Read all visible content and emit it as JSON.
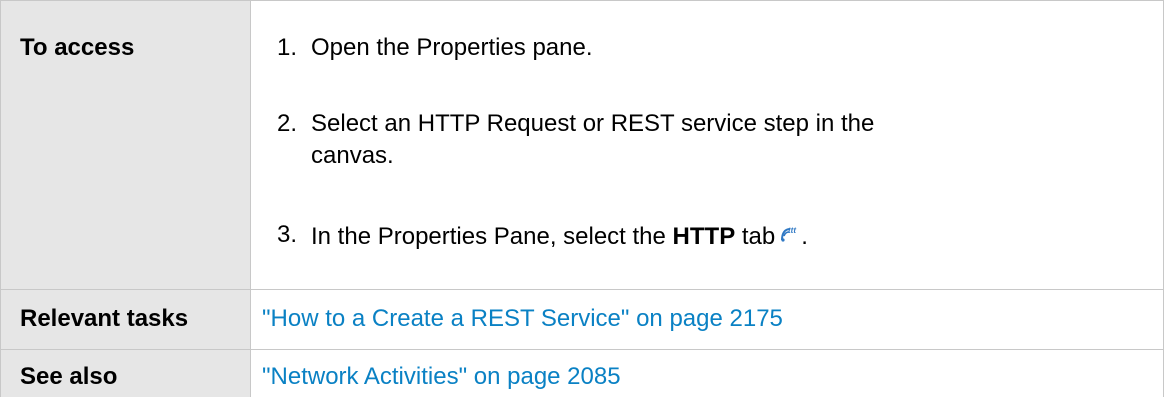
{
  "table": {
    "rows": {
      "access": {
        "label": "To access",
        "steps": [
          {
            "num": "1.",
            "text": "Open the Properties pane."
          },
          {
            "num": "2.",
            "text": "Select an HTTP Request or REST service step in the canvas."
          },
          {
            "num": "3.",
            "text_before": "In the Properties Pane, select the ",
            "bold": "HTTP",
            "text_after": " tab",
            "icon": "http-tab-icon",
            "end": "."
          }
        ]
      },
      "tasks": {
        "label": "Relevant tasks",
        "link": "\"How to a Create a REST Service\" on page 2175"
      },
      "see_also": {
        "label": "See also",
        "link": "\"Network Activities\" on page 2085"
      }
    }
  },
  "colors": {
    "label_background": "#e6e6e6",
    "link": "#0a81c4",
    "border": "#c8c8c8"
  }
}
